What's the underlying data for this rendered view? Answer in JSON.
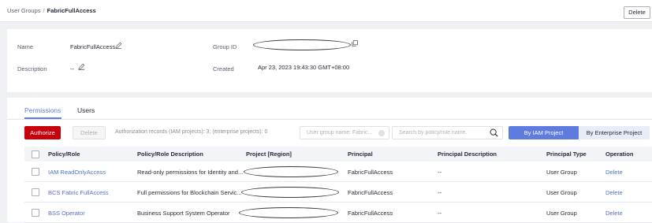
{
  "breadcrumb": {
    "root": "User Groups",
    "separator": "/",
    "current": "FabricFullAccess"
  },
  "header": {
    "delete_label": "Delete"
  },
  "info": {
    "name_label": "Name",
    "name_value": "FabricFullAccess",
    "description_label": "Description",
    "description_value": "--",
    "group_id_label": "Group ID",
    "group_id_value": "",
    "created_label": "Created",
    "created_value": "Apr 23, 2023 19:43:30 GMT+08:00"
  },
  "tabs": [
    {
      "label": "Permissions",
      "active": true
    },
    {
      "label": "Users",
      "active": false
    }
  ],
  "toolbar": {
    "authorize_label": "Authorize",
    "delete_label": "Delete",
    "records_text": "Authorization records (IAM projects): 3; (enterprise projects): 0",
    "filter_placeholder": "User group name: Fabric...",
    "search_placeholder": "Search by policy/role name.",
    "by_iam_label": "By IAM Project",
    "by_enterprise_label": "By Enterprise Project"
  },
  "table": {
    "columns": [
      "Policy/Role",
      "Policy/Role Description",
      "Project [Region]",
      "Principal",
      "Principal Description",
      "Principal Type",
      "Operation"
    ],
    "rows": [
      {
        "policy": "IAM ReadOnlyAccess",
        "description": "Read-only permissions for Identity and...",
        "project": "",
        "principal": "FabricFullAccess",
        "principal_description": "--",
        "principal_type": "User Group",
        "operation": "Delete"
      },
      {
        "policy": "BCS Fabric FullAccess",
        "description": "Full permissions for Blockchain Servic...",
        "project": "",
        "principal": "FabricFullAccess",
        "principal_description": "--",
        "principal_type": "User Group",
        "operation": "Delete"
      },
      {
        "policy": "BSS Operator",
        "description": "Business Support System Operator",
        "project": "",
        "principal": "FabricFullAccess",
        "principal_description": "--",
        "principal_type": "User Group",
        "operation": "Delete"
      }
    ]
  },
  "colors": {
    "accent": "#5e7ce0",
    "danger": "#c7000b",
    "link": "#526ecc"
  },
  "icons": [
    "edit-icon",
    "copy-icon",
    "search-icon",
    "clear-icon"
  ]
}
